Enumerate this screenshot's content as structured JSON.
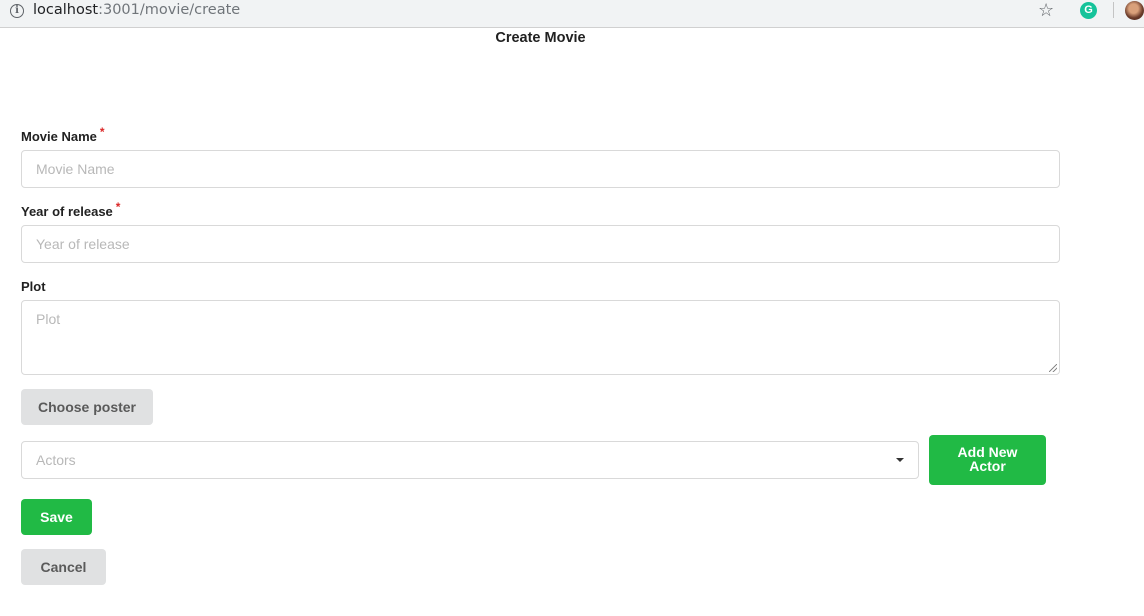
{
  "browser": {
    "url_host": "localhost",
    "url_path": ":3001/movie/create",
    "info_icon": "info-icon",
    "star_icon": "star-icon",
    "extension_icon": "grammarly-icon",
    "extension_letter": "G"
  },
  "page": {
    "title": "Create Movie"
  },
  "form": {
    "movie_name": {
      "label": "Movie Name",
      "required_mark": "*",
      "placeholder": "Movie Name",
      "value": ""
    },
    "year": {
      "label": "Year of release",
      "required_mark": "*",
      "placeholder": "Year of release",
      "value": ""
    },
    "plot": {
      "label": "Plot",
      "placeholder": "Plot",
      "value": ""
    },
    "choose_poster_label": "Choose poster",
    "actors": {
      "placeholder": "Actors"
    },
    "add_actor_line1": "Add New",
    "add_actor_line2": "Actor",
    "save_label": "Save",
    "cancel_label": "Cancel"
  },
  "colors": {
    "accent_green": "#21ba45",
    "required_red": "#db2828",
    "neutral_button": "#e0e1e2"
  }
}
